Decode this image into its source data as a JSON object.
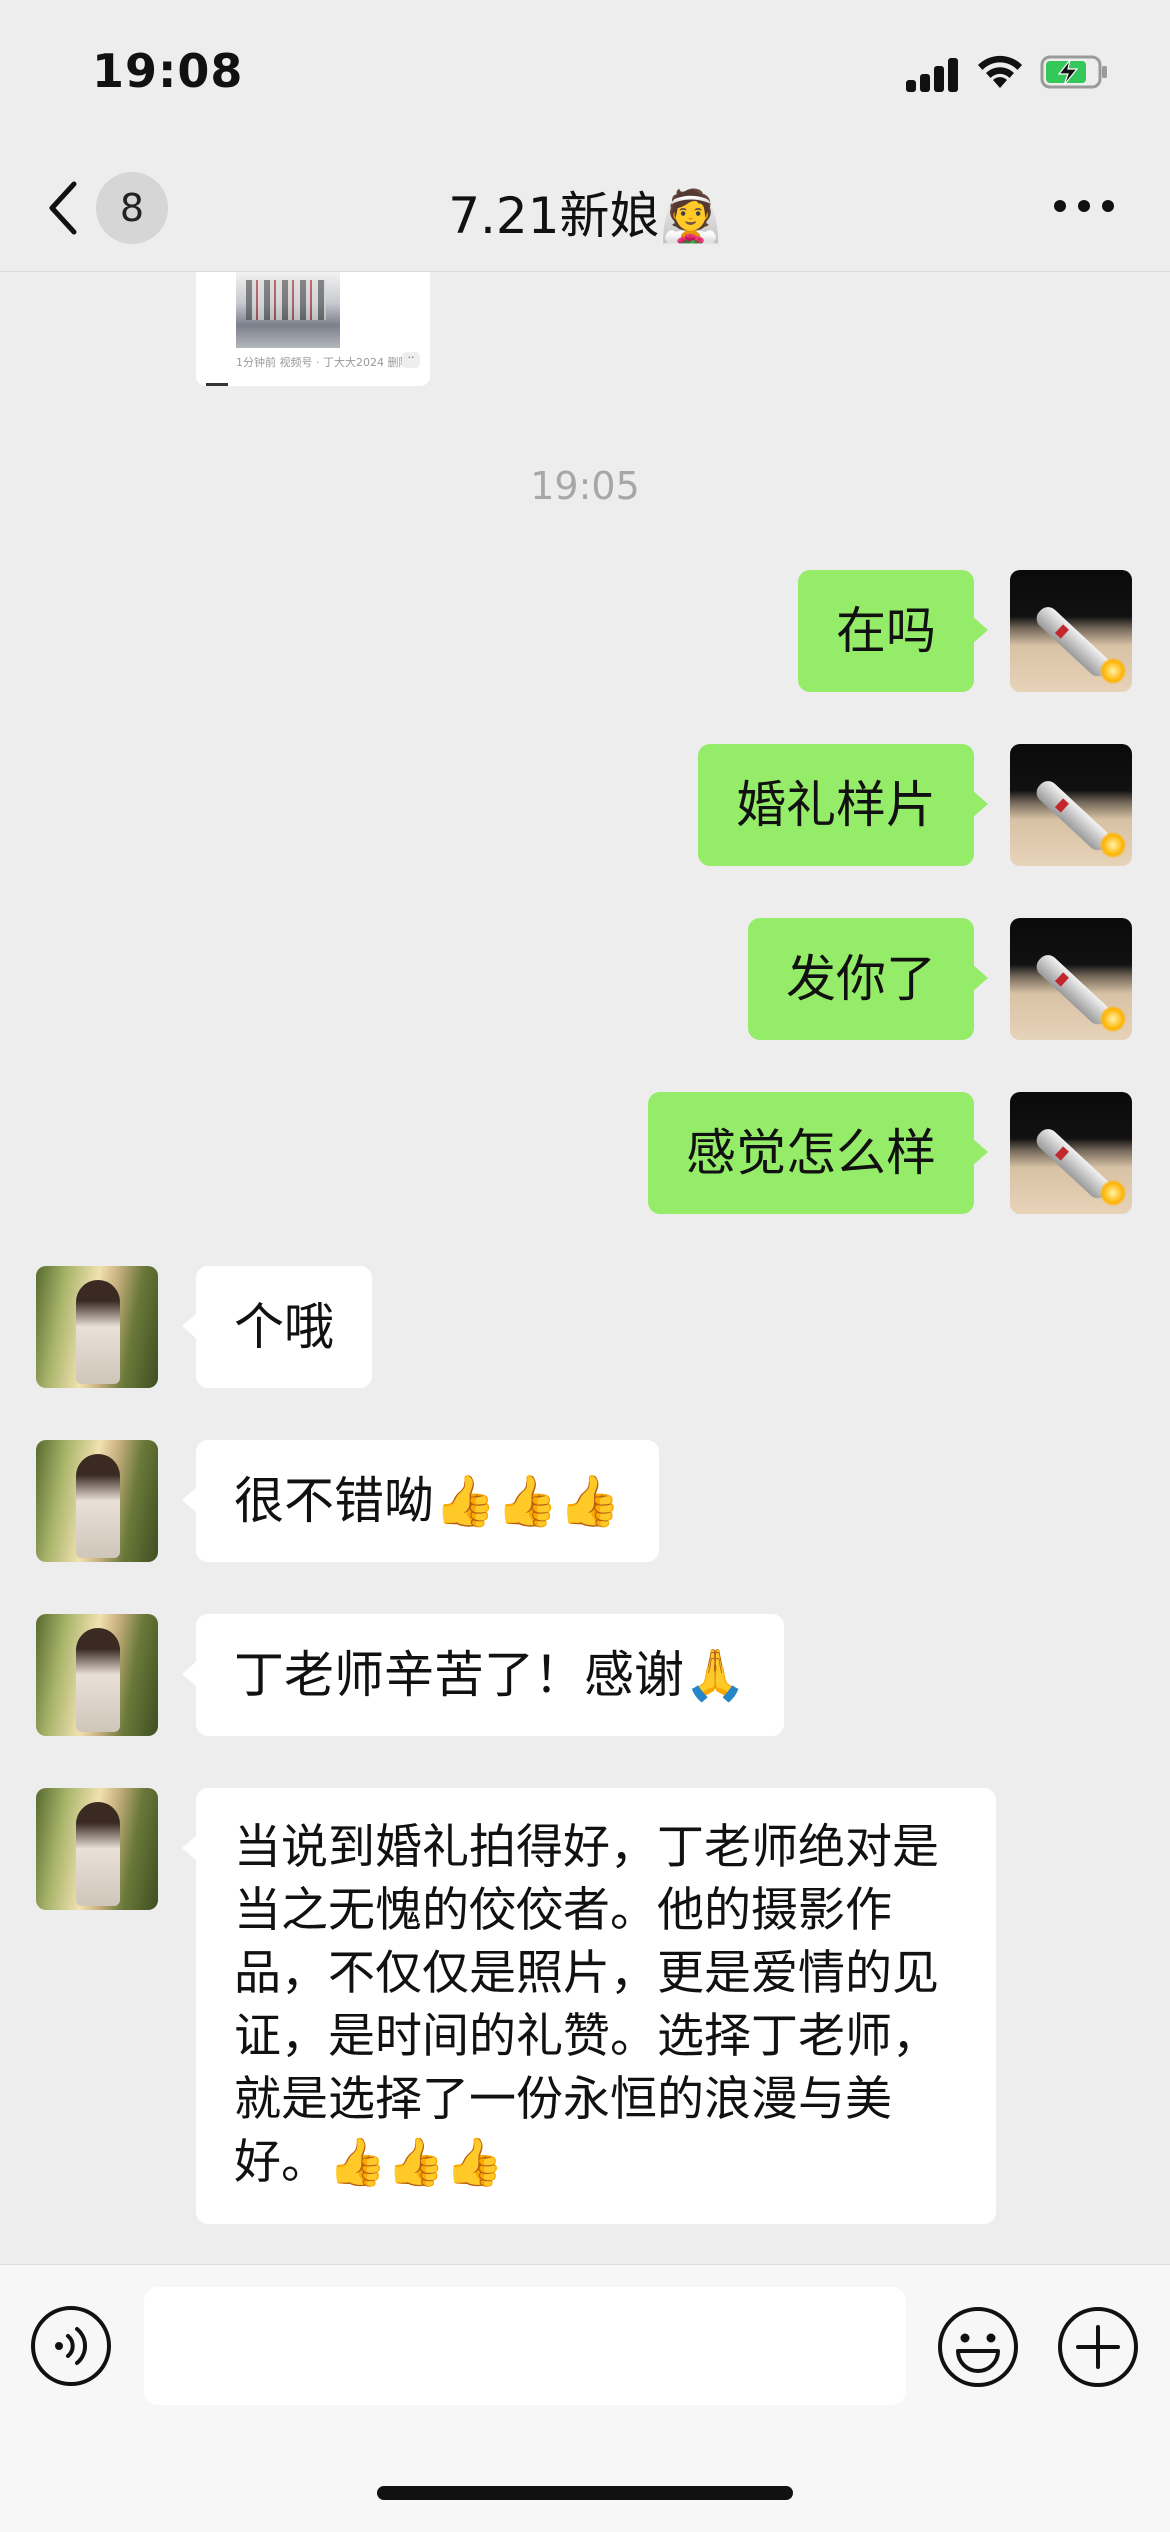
{
  "status_bar": {
    "time": "19:08"
  },
  "nav": {
    "unread_count": "8",
    "title": "7.21新娘👰"
  },
  "shared_card": {
    "meta": "1分钟前  视频号 · 丁大大2024  删除",
    "more": "··"
  },
  "timestamp": "19:05",
  "messages": [
    {
      "side": "out",
      "text": "在吗"
    },
    {
      "side": "out",
      "text": "婚礼样片"
    },
    {
      "side": "out",
      "text": "发你了"
    },
    {
      "side": "out",
      "text": "感觉怎么样"
    },
    {
      "side": "in",
      "text": "个哦"
    },
    {
      "side": "in",
      "text": "很不错呦👍👍👍"
    },
    {
      "side": "in",
      "text": "丁老师辛苦了！感谢🙏"
    },
    {
      "side": "in",
      "text": "当说到婚礼拍得好，丁老师绝对是当之无愧的佼佼者。他的摄影作品，不仅仅是照片，更是爱情的见证，是时间的礼赞。选择丁老师，就是选择了一份永恒的浪漫与美好。👍👍👍"
    }
  ],
  "input": {
    "value": ""
  },
  "icons": {
    "back": "chevron-left-icon",
    "more": "more-dots-icon",
    "voice": "voice-icon",
    "emoji": "emoji-icon",
    "plus": "plus-icon"
  },
  "colors": {
    "outgoing_bubble": "#95ec69",
    "incoming_bubble": "#ffffff",
    "background": "#ededed"
  }
}
